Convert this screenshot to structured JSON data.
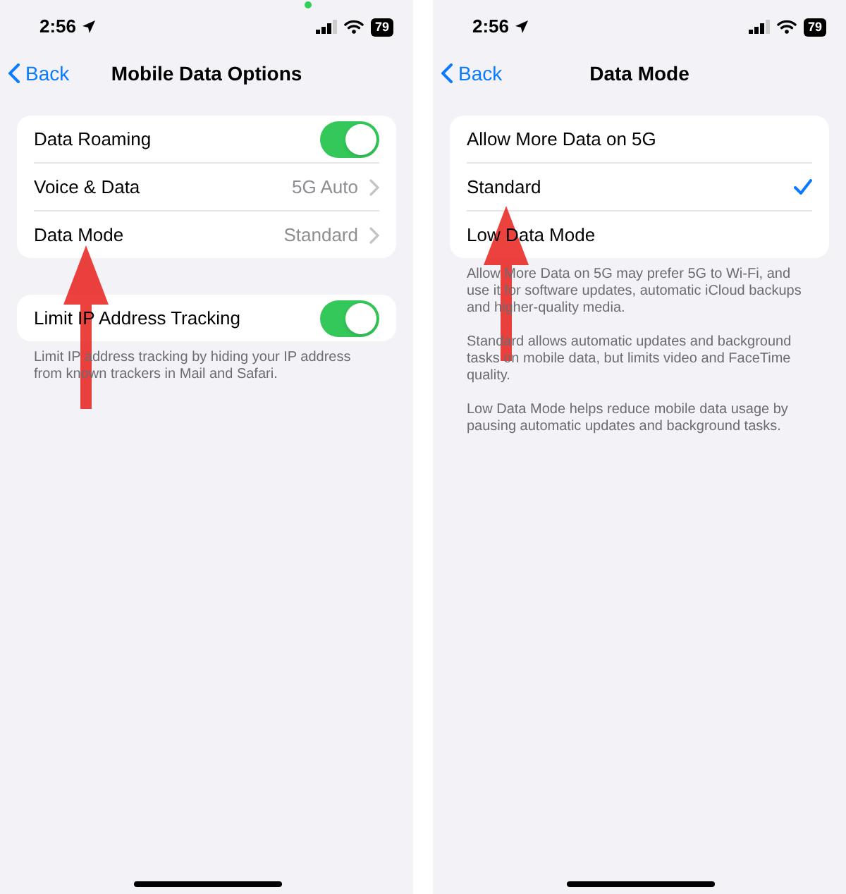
{
  "screens": [
    {
      "status": {
        "time": "2:56",
        "battery": "79",
        "mic_dot": true
      },
      "back": "Back",
      "title": "Mobile Data Options",
      "groups": [
        {
          "rows": [
            {
              "kind": "toggle",
              "label": "Data Roaming",
              "on": true
            },
            {
              "kind": "detail",
              "label": "Voice & Data",
              "value": "5G Auto"
            },
            {
              "kind": "detail",
              "label": "Data Mode",
              "value": "Standard"
            }
          ]
        },
        {
          "rows": [
            {
              "kind": "toggle",
              "label": "Limit IP Address Tracking",
              "on": true
            }
          ],
          "footer": [
            "Limit IP address tracking by hiding your IP address from known trackers in Mail and Safari."
          ]
        }
      ]
    },
    {
      "status": {
        "time": "2:56",
        "battery": "79"
      },
      "back": "Back",
      "title": "Data Mode",
      "groups": [
        {
          "rows": [
            {
              "kind": "option",
              "label": "Allow More Data on 5G",
              "selected": false
            },
            {
              "kind": "option",
              "label": "Standard",
              "selected": true
            },
            {
              "kind": "option",
              "label": "Low Data Mode",
              "selected": false
            }
          ],
          "footer": [
            "Allow More Data on 5G may prefer 5G to Wi-Fi, and use it for software updates, automatic iCloud backups and higher-quality media.",
            "Standard allows automatic updates and background tasks on mobile data, but limits video and FaceTime quality.",
            "Low Data Mode helps reduce mobile data usage by pausing automatic updates and background tasks."
          ]
        }
      ]
    }
  ]
}
